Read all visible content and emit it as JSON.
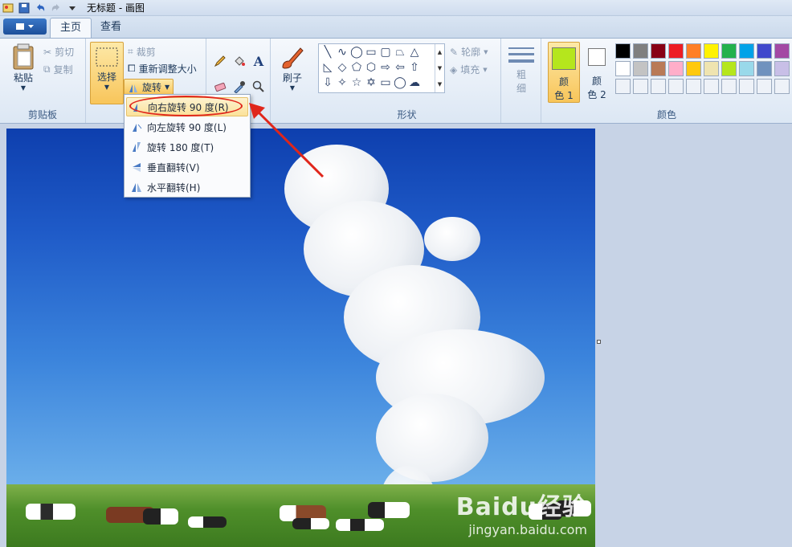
{
  "window": {
    "title": "无标题 - 画图"
  },
  "tabs": {
    "home": "主页",
    "view": "查看"
  },
  "clipboard": {
    "paste": "粘贴",
    "cut": "剪切",
    "copy": "复制",
    "label": "剪贴板"
  },
  "image": {
    "select": "选择",
    "crop": "裁剪",
    "resize": "重新调整大小",
    "rotate": "旋转"
  },
  "tools": {
    "brush": "刷子"
  },
  "shapes": {
    "outline": "轮廓",
    "fill": "填充",
    "label": "形状"
  },
  "size": {
    "line1": "粗",
    "line2": "细"
  },
  "colors": {
    "color1_line1": "颜",
    "color1_line2": "色 1",
    "color2_line1": "颜",
    "color2_line2": "色 2",
    "label": "颜色",
    "color1_value": "#b5e61d",
    "color2_value": "#ffffff",
    "palette_row1": [
      "#000000",
      "#7f7f7f",
      "#880015",
      "#ed1c24",
      "#ff7f27",
      "#fff200",
      "#22b14c",
      "#00a2e8",
      "#3f48cc",
      "#a349a4"
    ],
    "palette_row2": [
      "#ffffff",
      "#c3c3c3",
      "#b97a57",
      "#ffaec9",
      "#ffc90e",
      "#efe4b0",
      "#b5e61d",
      "#99d9ea",
      "#7092be",
      "#c8bfe7"
    ]
  },
  "rotate_menu": {
    "items": [
      "向右旋转 90 度(R)",
      "向左旋转 90 度(L)",
      "旋转 180 度(T)",
      "垂直翻转(V)",
      "水平翻转(H)"
    ]
  },
  "watermark": {
    "brand": "Baidu经验",
    "url": "jingyan.baidu.com"
  }
}
